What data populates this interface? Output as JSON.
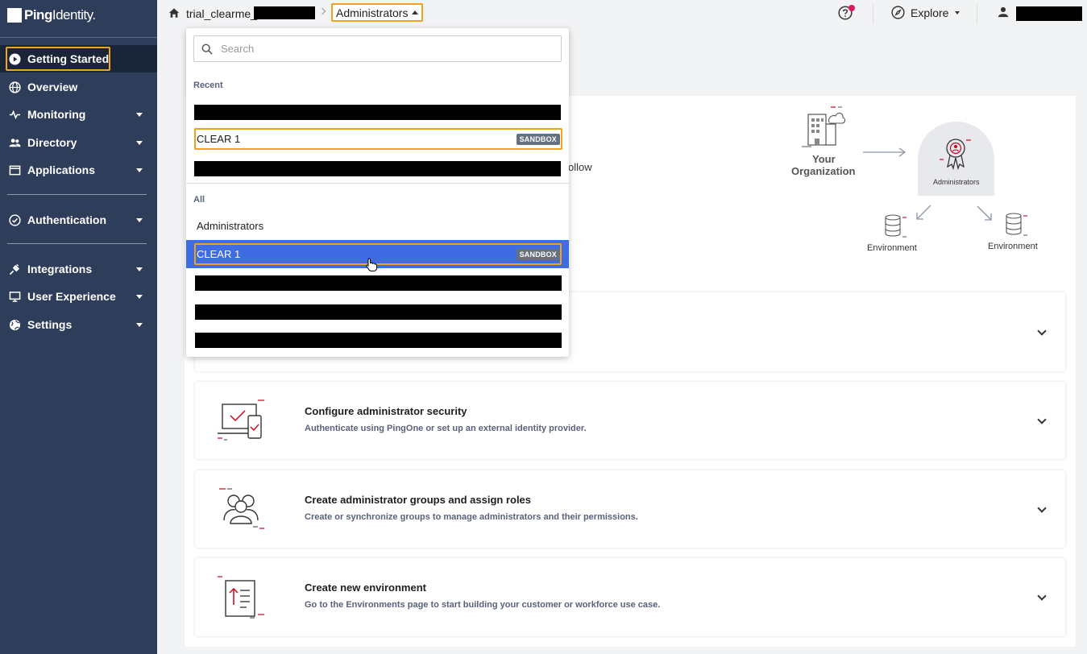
{
  "brand": {
    "logo_bold": "Ping",
    "logo_thin": "Identity."
  },
  "sidebar": {
    "items": [
      {
        "label": "Getting Started",
        "icon": "play-circle-icon"
      },
      {
        "label": "Overview",
        "icon": "globe-icon"
      },
      {
        "label": "Monitoring",
        "icon": "pulse-icon"
      },
      {
        "label": "Directory",
        "icon": "users-icon"
      },
      {
        "label": "Applications",
        "icon": "window-icon"
      },
      {
        "label": "Authentication",
        "icon": "check-circle-icon"
      },
      {
        "label": "Integrations",
        "icon": "plug-icon"
      },
      {
        "label": "User Experience",
        "icon": "monitor-icon"
      },
      {
        "label": "Settings",
        "icon": "globe-icon"
      }
    ]
  },
  "topbar": {
    "environment_prefix": "trial_clearme_",
    "organization": "Administrators",
    "explore_label": "Explore"
  },
  "dropdown": {
    "search_placeholder": "Search",
    "recent_label": "Recent",
    "recent": [
      {
        "label": "",
        "redacted": true
      },
      {
        "label": "CLEAR 1",
        "badge": "SANDBOX"
      },
      {
        "label": "",
        "redacted": true
      }
    ],
    "all_label": "All",
    "all": [
      {
        "label": "Administrators"
      },
      {
        "label": "CLEAR 1",
        "badge": "SANDBOX",
        "selected": true
      },
      {
        "label": "",
        "redacted": true
      },
      {
        "label": "",
        "redacted": true
      },
      {
        "label": "",
        "redacted": true
      }
    ]
  },
  "main": {
    "partial_text": "ollow",
    "diagram": {
      "org_line1": "Your",
      "org_line2": "Organization",
      "admin_label": "Administrators",
      "env_left": "Environment",
      "env_right": "Environment"
    },
    "tasks": [
      {
        "title": "Configure administrator security",
        "desc": "Authenticate using PingOne or set up an external identity provider.",
        "icon": "laptop-shield-icon"
      },
      {
        "title": "Create administrator groups and assign roles",
        "desc": "Create or synchronize groups to manage administrators and their permissions.",
        "icon": "group-icon"
      },
      {
        "title": "Create new environment",
        "desc": "Go to the Environments page to start building your customer or workforce use case.",
        "icon": "document-upload-icon"
      }
    ]
  },
  "colors": {
    "sidebar": "#2e3d5a",
    "highlight": "#f0a31c",
    "selected": "#3f6be3",
    "accent_red": "#d0021b"
  }
}
